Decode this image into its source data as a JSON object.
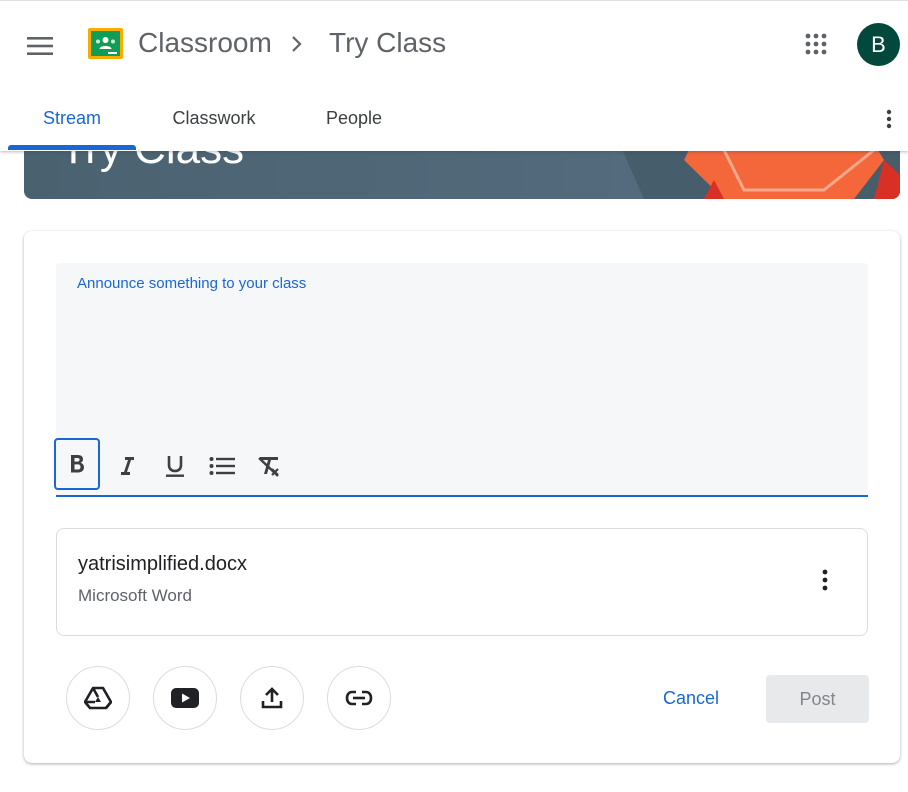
{
  "header": {
    "app_name": "Classroom",
    "class_name": "Try Class",
    "avatar_initial": "B",
    "avatar_color": "#03483c",
    "icons": [
      "hamburger-menu-icon",
      "classroom-logo-icon",
      "chevron-right-icon",
      "google-apps-icon"
    ]
  },
  "tabs": [
    {
      "label": "Stream",
      "active": true
    },
    {
      "label": "Classwork",
      "active": false
    },
    {
      "label": "People",
      "active": false
    }
  ],
  "banner": {
    "title": "Try Class",
    "colors": {
      "base": "#51697a",
      "accent": "#f4673a"
    }
  },
  "composer": {
    "placeholder": "Announce something to your class",
    "formatting": [
      "bold",
      "italic",
      "underline",
      "bulleted-list",
      "clear-formatting"
    ],
    "bold_selected": true
  },
  "attachment": {
    "file_name": "yatrisimplified.docx",
    "file_type": "Microsoft Word"
  },
  "actions": {
    "add_buttons": [
      "google-drive-icon",
      "youtube-icon",
      "upload-icon",
      "link-icon"
    ],
    "cancel_label": "Cancel",
    "post_label": "Post",
    "post_enabled": false
  },
  "colors": {
    "accent": "#1967d2",
    "text": "#3c4043"
  }
}
